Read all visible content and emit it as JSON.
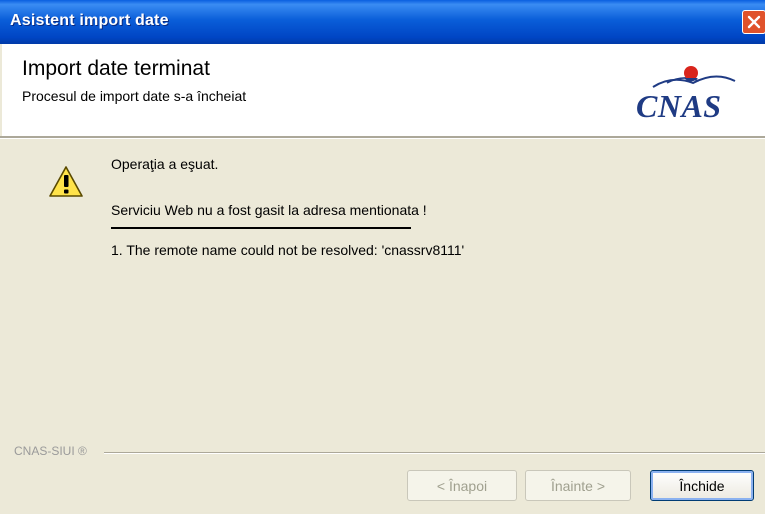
{
  "window": {
    "title": "Asistent import date"
  },
  "header": {
    "title": "Import date terminat",
    "subtitle": "Procesul de import date s-a încheiat",
    "logo_text": "CNAS"
  },
  "content": {
    "icon": "warning-icon",
    "status_message": "Operaţia a eşuat.",
    "error_message": "Serviciu Web nu a fost gasit la adresa mentionata !",
    "error_details": "1. The remote name could not be resolved: 'cnassrv8111'"
  },
  "footer": {
    "brand": "CNAS-SIUI ®",
    "back_label": "< Înapoi",
    "next_label": "Înainte >",
    "close_label": "Închide"
  },
  "colors": {
    "titlebar": "#0a5ed9",
    "window_bg": "#ece9d8",
    "close_button": "#e0522b",
    "logo_blue": "#1f3b84",
    "logo_red": "#d9251c"
  }
}
